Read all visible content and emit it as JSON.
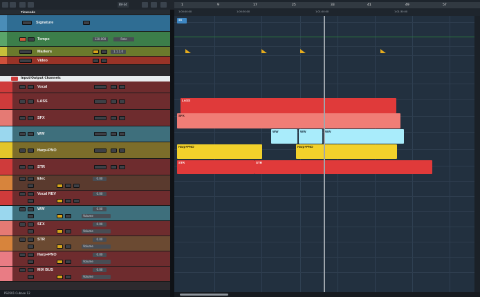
{
  "toolbar": {
    "readout": "BV-34"
  },
  "tracks": [
    {
      "id": "signature",
      "name": "Signature",
      "color": "#2f6d93",
      "section": "ruler"
    },
    {
      "id": "tempo",
      "name": "Tempo",
      "color": "#3c7e4a",
      "value": "120.000",
      "value2": "Rate"
    },
    {
      "id": "markers",
      "name": "Markers",
      "color": "#6b7a2c",
      "value": "1.1.1.0"
    },
    {
      "id": "video",
      "name": "Video",
      "color": "#9a3327"
    },
    {
      "id": "folder",
      "name": "Input/Output Channels"
    },
    {
      "id": "vocal",
      "name": "Vocal",
      "color": "#7a2d2d",
      "stripColor": "#cf3b3b"
    },
    {
      "id": "lass",
      "name": "LASS",
      "color": "#7a2d2d",
      "stripColor": "#cf3b3b"
    },
    {
      "id": "sfx",
      "name": "SFX",
      "color": "#7a2d2d",
      "stripColor": "#e57a74"
    },
    {
      "id": "ww",
      "name": "WW",
      "color": "#3e6f7c",
      "stripColor": "#9ad7ee"
    },
    {
      "id": "harp",
      "name": "Harp+PNO",
      "color": "#7c6d2a",
      "stripColor": "#e3c52a"
    },
    {
      "id": "str",
      "name": "STR",
      "color": "#7a2d2d",
      "stripColor": "#cf3b3b"
    },
    {
      "id": "elec",
      "name": "Elec",
      "color": "#5a3a2e",
      "stripColor": "#d7843c",
      "value": "0.00",
      "icon": "IN"
    },
    {
      "id": "vocalrev",
      "name": "Vocal REV",
      "color": "#7a2d2d",
      "stripColor": "#cf3b3b",
      "value": "0.00",
      "icon": "IN"
    },
    {
      "id": "ww2",
      "name": "WW",
      "color": "#3e6f7c",
      "stripColor": "#9ad7ee",
      "value": "0.00",
      "icon": "IN",
      "sub": "Volume"
    },
    {
      "id": "sfx2",
      "name": "SFX",
      "color": "#7a2d2d",
      "stripColor": "#e57a74",
      "value": "0.00",
      "icon": "IN",
      "sub": "Volume"
    },
    {
      "id": "str2",
      "name": "STR",
      "color": "#7a2d2d",
      "stripColor": "#cf3b3b",
      "value": "0.00",
      "icon": "IN",
      "sub": "Volume"
    },
    {
      "id": "harp2",
      "name": "Harp+PNO",
      "color": "#7c6d2a",
      "stripColor": "#e3c52a",
      "value": "0.00",
      "icon": "IN",
      "sub": "Volume"
    },
    {
      "id": "mixbus",
      "name": "MIX BUS",
      "color": "#7a2d2d",
      "stripColor": "#cf3b3b",
      "value": "0.00",
      "icon": "IN",
      "sub": "Volume"
    }
  ],
  "ruler_section_label": "Timecode",
  "ruler": {
    "bars": [
      "1",
      "9",
      "17",
      "25",
      "33",
      "41",
      "49",
      "57"
    ],
    "timecodes": [
      "1:00:00:00",
      "1:00:30:00",
      "1:01:00:00",
      "1:01:30:00"
    ]
  },
  "events": {
    "sig": "4/4",
    "lass": "LASS",
    "sfx": "SFX",
    "ww1": "WW",
    "ww2": "WW",
    "ww3": "WW",
    "harp1": "Harp+PNO",
    "harp2": "Harp+PNO",
    "str1": "STR",
    "str2": "STR"
  },
  "status": {
    "text": "PS0501 Cubase 12"
  },
  "colors": {
    "red": "#e03a3a",
    "salmon": "#f07d76",
    "cyan": "#a9ecfb",
    "yellow": "#f2d12b",
    "marker": "#e6ac1d",
    "arranger_bg": "#22303f"
  }
}
